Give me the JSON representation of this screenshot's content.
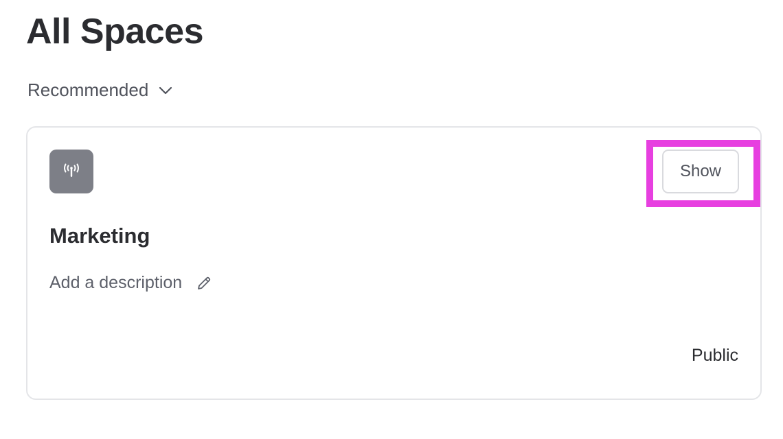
{
  "page": {
    "title": "All Spaces"
  },
  "sort": {
    "label": "Recommended",
    "icon": "chevron-down-icon"
  },
  "space_card": {
    "avatar_icon": "broadcast-tower-icon",
    "avatar_color": "#7d7f87",
    "show_button_label": "Show",
    "name": "Marketing",
    "description_placeholder": "Add a description",
    "edit_icon": "pencil-icon",
    "visibility": "Public"
  },
  "highlight_color": "#e73fe0"
}
